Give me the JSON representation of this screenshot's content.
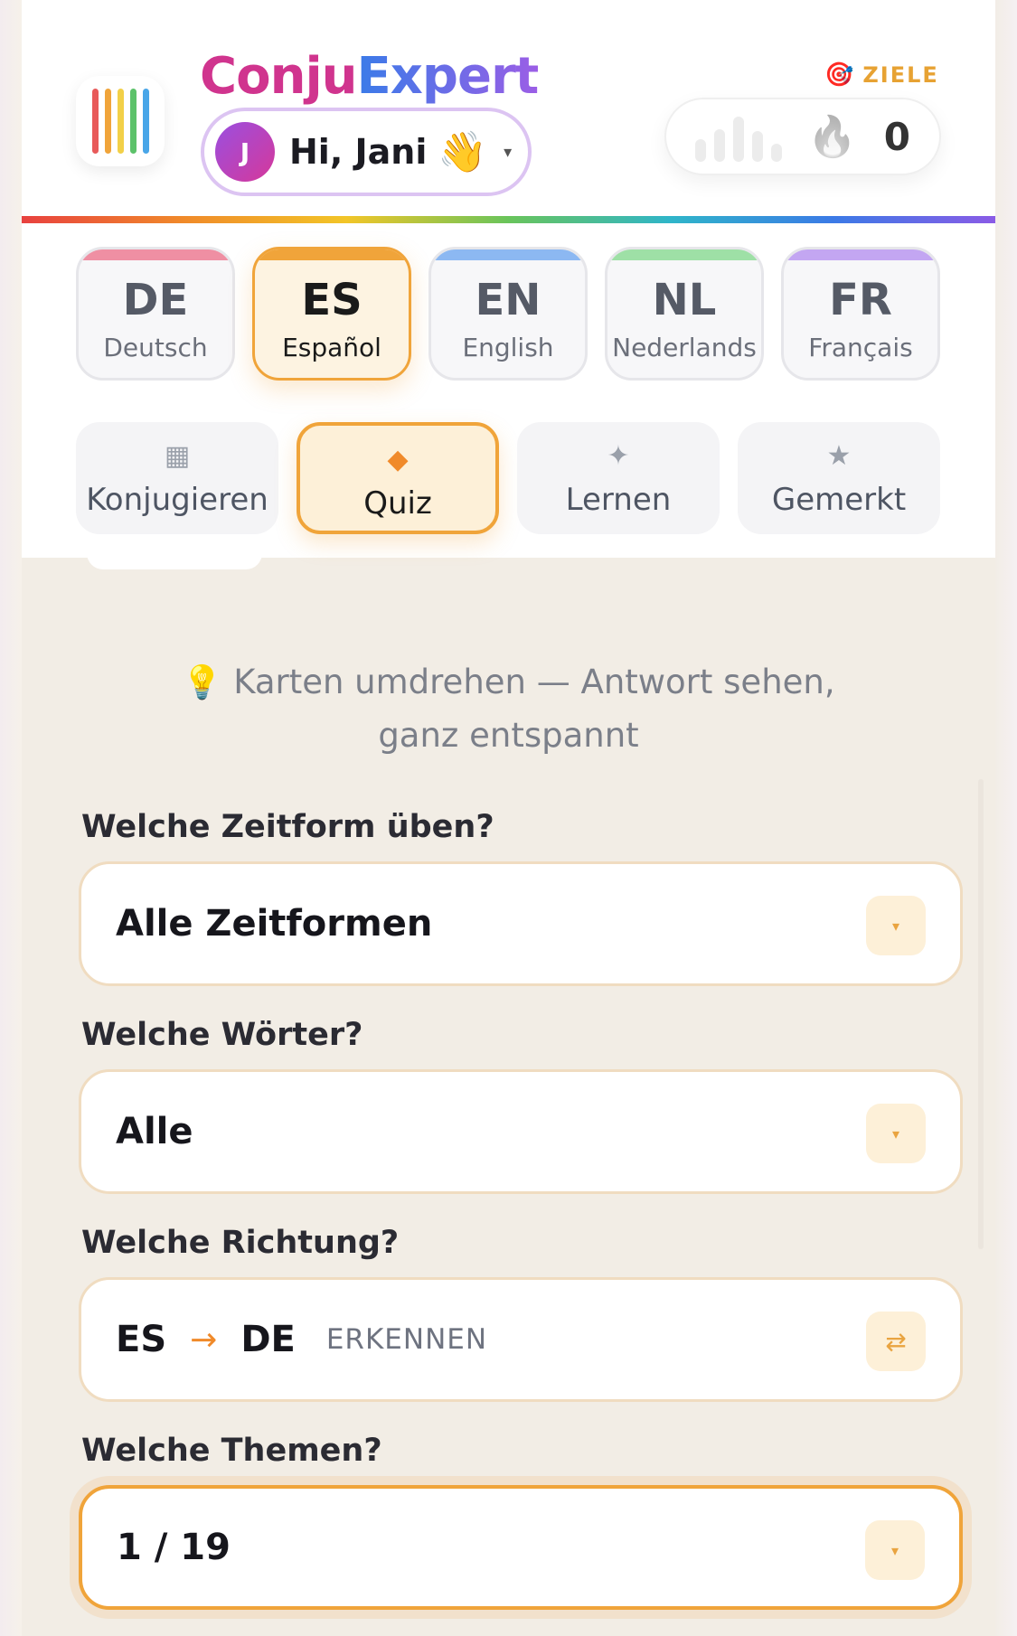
{
  "brand": {
    "part1": "Conju",
    "part2": "Expert"
  },
  "logo_colors": [
    "#e85a5a",
    "#f0a43a",
    "#f2d048",
    "#5cc26a",
    "#49a6e8"
  ],
  "user": {
    "initial": "J",
    "greeting": "Hi, Jani",
    "wave": "👋",
    "caret": "▾"
  },
  "goals": {
    "icon": "🎯",
    "label": "ZIELE"
  },
  "streak": {
    "count": "0",
    "flame": "🔥",
    "bars": [
      0.45,
      0.65,
      0.9,
      0.6,
      0.35
    ]
  },
  "languages": [
    {
      "code": "DE",
      "name": "Deutsch",
      "color": "#ef8fa3",
      "active": false
    },
    {
      "code": "ES",
      "name": "Español",
      "color": "#f0a43a",
      "active": true
    },
    {
      "code": "EN",
      "name": "English",
      "color": "#8cb8f2",
      "active": false
    },
    {
      "code": "NL",
      "name": "Nederlands",
      "color": "#9ee0a6",
      "active": false
    },
    {
      "code": "FR",
      "name": "Français",
      "color": "#c3a6f2",
      "active": false
    }
  ],
  "modes": [
    {
      "icon": "▦",
      "label": "Konjugieren",
      "active": false
    },
    {
      "icon": "◆",
      "label": "Quiz",
      "active": true
    },
    {
      "icon": "✦",
      "label": "Lernen",
      "active": false
    },
    {
      "icon": "★",
      "label": "Gemerkt",
      "active": false
    }
  ],
  "hint": {
    "icon": "💡",
    "line1": "Karten umdrehen — Antwort sehen,",
    "line2": "ganz entspannt"
  },
  "tense": {
    "label": "Welche Zeitform üben?",
    "value": "Alle Zeitformen"
  },
  "words": {
    "label": "Welche Wörter?",
    "value": "Alle"
  },
  "direction": {
    "label": "Welche Richtung?",
    "from": "ES",
    "arrow": "→",
    "to": "DE",
    "mode": "ERKENNEN",
    "swap": "⇄"
  },
  "topics": {
    "label": "Welche Themen?",
    "value": "1 / 19"
  },
  "dropdown_caret": "▾"
}
